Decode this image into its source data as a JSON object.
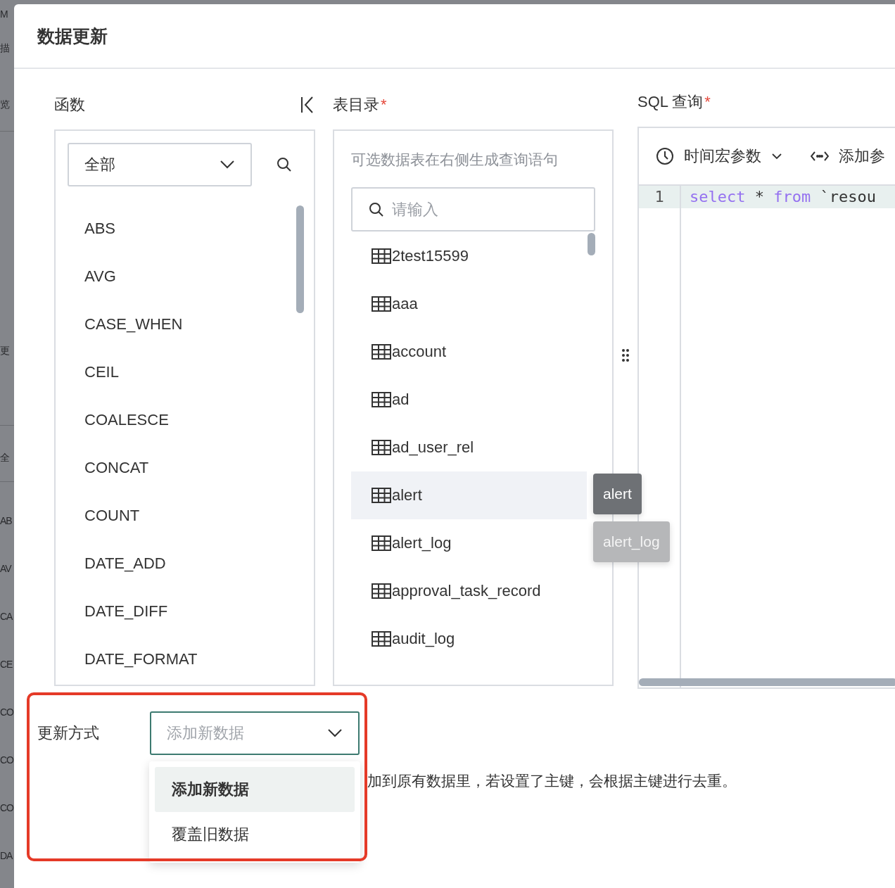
{
  "background_fragments": [
    "M",
    "描",
    "览",
    "更",
    "全",
    "AB",
    "AV",
    "CA",
    "CE",
    "CO",
    "CO",
    "CO",
    "DA"
  ],
  "dialog": {
    "title": "数据更新"
  },
  "functions": {
    "label": "函数",
    "filter": {
      "value": "全部"
    },
    "items": [
      "ABS",
      "AVG",
      "CASE_WHEN",
      "CEIL",
      "COALESCE",
      "CONCAT",
      "COUNT",
      "DATE_ADD",
      "DATE_DIFF",
      "DATE_FORMAT"
    ]
  },
  "table_directory": {
    "label": "表目录",
    "required": true,
    "hint": "可选数据表在右侧生成查询语句",
    "search": {
      "placeholder": "请输入"
    },
    "tables": [
      {
        "name": "2test15599",
        "selected": false
      },
      {
        "name": "aaa",
        "selected": false
      },
      {
        "name": "account",
        "selected": false
      },
      {
        "name": "ad",
        "selected": false
      },
      {
        "name": "ad_user_rel",
        "selected": false
      },
      {
        "name": "alert",
        "selected": true,
        "tooltip": {
          "text": "alert",
          "fading": false
        }
      },
      {
        "name": "alert_log",
        "selected": false,
        "tooltip": {
          "text": "alert_log",
          "fading": true
        }
      },
      {
        "name": "approval_task_record",
        "selected": false
      },
      {
        "name": "audit_log",
        "selected": false
      }
    ]
  },
  "sql_query": {
    "label": "SQL 查询",
    "required": true,
    "toolbar": [
      {
        "kind": "clock",
        "label": "时间宏参数",
        "dropdown": true
      },
      {
        "kind": "code",
        "label": "添加参",
        "dropdown": false
      }
    ],
    "lines": [
      {
        "number": "1",
        "tokens": [
          {
            "text": "select",
            "kind": "keyword"
          },
          {
            "text": " * ",
            "kind": "plain"
          },
          {
            "text": "from",
            "kind": "keyword"
          },
          {
            "text": " `resou",
            "kind": "plain"
          }
        ]
      }
    ]
  },
  "update_mode": {
    "label": "更新方式",
    "value": "添加新数据",
    "open": true,
    "options": [
      {
        "label": "添加新数据",
        "selected": true
      },
      {
        "label": "覆盖旧数据",
        "selected": false
      }
    ],
    "description": "加到原有数据里，若设置了主键，会根据主键进行去重。"
  }
}
